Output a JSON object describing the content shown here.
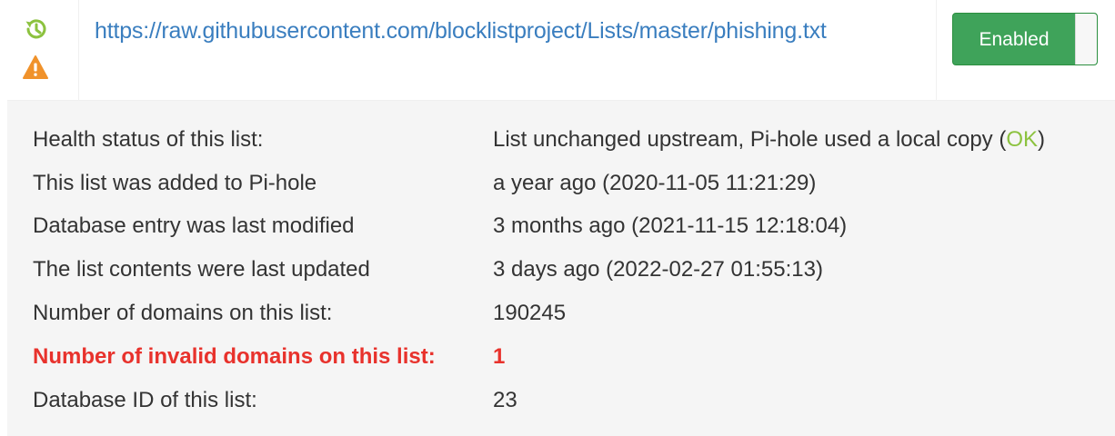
{
  "list": {
    "url": "https://raw.githubusercontent.com/blocklistproject/Lists/master/phishing.txt",
    "icons": {
      "status": "history-icon",
      "alert": "warning-icon"
    },
    "toggle_label": "Enabled",
    "enabled": true
  },
  "details": {
    "health": {
      "label": "Health status of this list:",
      "value_prefix": "List unchanged upstream, Pi-hole used a local copy (",
      "value_ok": "OK",
      "value_suffix": ")"
    },
    "added": {
      "label": "This list was added to Pi-hole",
      "value": "a year ago (2020-11-05 11:21:29)"
    },
    "modified": {
      "label": "Database entry was last modified",
      "value": "3 months ago (2021-11-15 12:18:04)"
    },
    "updated": {
      "label": "The list contents were last updated",
      "value": "3 days ago (2022-02-27 01:55:13)"
    },
    "domains": {
      "label": "Number of domains on this list:",
      "value": "190245"
    },
    "invalid": {
      "label": "Number of invalid domains on this list:",
      "value": "1"
    },
    "db_id": {
      "label": "Database ID of this list:",
      "value": "23"
    }
  },
  "colors": {
    "link": "#3a7ebf",
    "toggle_bg": "#3fa35a",
    "ok": "#8cc23f",
    "error": "#e8322c",
    "history_icon": "#8cc23f",
    "warning_icon": "#f0922b"
  }
}
